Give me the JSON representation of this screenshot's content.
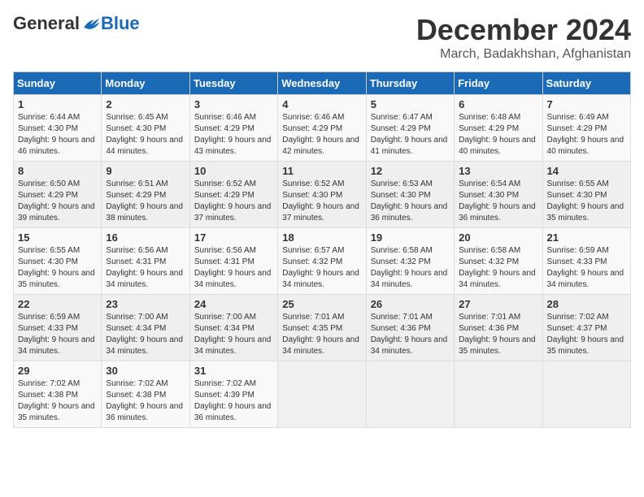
{
  "logo": {
    "general": "General",
    "blue": "Blue"
  },
  "header": {
    "title": "December 2024",
    "subtitle": "March, Badakhshan, Afghanistan"
  },
  "weekdays": [
    "Sunday",
    "Monday",
    "Tuesday",
    "Wednesday",
    "Thursday",
    "Friday",
    "Saturday"
  ],
  "weeks": [
    [
      {
        "day": "1",
        "sunrise": "6:44 AM",
        "sunset": "4:30 PM",
        "daylight": "9 hours and 46 minutes."
      },
      {
        "day": "2",
        "sunrise": "6:45 AM",
        "sunset": "4:30 PM",
        "daylight": "9 hours and 44 minutes."
      },
      {
        "day": "3",
        "sunrise": "6:46 AM",
        "sunset": "4:29 PM",
        "daylight": "9 hours and 43 minutes."
      },
      {
        "day": "4",
        "sunrise": "6:46 AM",
        "sunset": "4:29 PM",
        "daylight": "9 hours and 42 minutes."
      },
      {
        "day": "5",
        "sunrise": "6:47 AM",
        "sunset": "4:29 PM",
        "daylight": "9 hours and 41 minutes."
      },
      {
        "day": "6",
        "sunrise": "6:48 AM",
        "sunset": "4:29 PM",
        "daylight": "9 hours and 40 minutes."
      },
      {
        "day": "7",
        "sunrise": "6:49 AM",
        "sunset": "4:29 PM",
        "daylight": "9 hours and 40 minutes."
      }
    ],
    [
      {
        "day": "8",
        "sunrise": "6:50 AM",
        "sunset": "4:29 PM",
        "daylight": "9 hours and 39 minutes."
      },
      {
        "day": "9",
        "sunrise": "6:51 AM",
        "sunset": "4:29 PM",
        "daylight": "9 hours and 38 minutes."
      },
      {
        "day": "10",
        "sunrise": "6:52 AM",
        "sunset": "4:29 PM",
        "daylight": "9 hours and 37 minutes."
      },
      {
        "day": "11",
        "sunrise": "6:52 AM",
        "sunset": "4:30 PM",
        "daylight": "9 hours and 37 minutes."
      },
      {
        "day": "12",
        "sunrise": "6:53 AM",
        "sunset": "4:30 PM",
        "daylight": "9 hours and 36 minutes."
      },
      {
        "day": "13",
        "sunrise": "6:54 AM",
        "sunset": "4:30 PM",
        "daylight": "9 hours and 36 minutes."
      },
      {
        "day": "14",
        "sunrise": "6:55 AM",
        "sunset": "4:30 PM",
        "daylight": "9 hours and 35 minutes."
      }
    ],
    [
      {
        "day": "15",
        "sunrise": "6:55 AM",
        "sunset": "4:30 PM",
        "daylight": "9 hours and 35 minutes."
      },
      {
        "day": "16",
        "sunrise": "6:56 AM",
        "sunset": "4:31 PM",
        "daylight": "9 hours and 34 minutes."
      },
      {
        "day": "17",
        "sunrise": "6:56 AM",
        "sunset": "4:31 PM",
        "daylight": "9 hours and 34 minutes."
      },
      {
        "day": "18",
        "sunrise": "6:57 AM",
        "sunset": "4:32 PM",
        "daylight": "9 hours and 34 minutes."
      },
      {
        "day": "19",
        "sunrise": "6:58 AM",
        "sunset": "4:32 PM",
        "daylight": "9 hours and 34 minutes."
      },
      {
        "day": "20",
        "sunrise": "6:58 AM",
        "sunset": "4:32 PM",
        "daylight": "9 hours and 34 minutes."
      },
      {
        "day": "21",
        "sunrise": "6:59 AM",
        "sunset": "4:33 PM",
        "daylight": "9 hours and 34 minutes."
      }
    ],
    [
      {
        "day": "22",
        "sunrise": "6:59 AM",
        "sunset": "4:33 PM",
        "daylight": "9 hours and 34 minutes."
      },
      {
        "day": "23",
        "sunrise": "7:00 AM",
        "sunset": "4:34 PM",
        "daylight": "9 hours and 34 minutes."
      },
      {
        "day": "24",
        "sunrise": "7:00 AM",
        "sunset": "4:34 PM",
        "daylight": "9 hours and 34 minutes."
      },
      {
        "day": "25",
        "sunrise": "7:01 AM",
        "sunset": "4:35 PM",
        "daylight": "9 hours and 34 minutes."
      },
      {
        "day": "26",
        "sunrise": "7:01 AM",
        "sunset": "4:36 PM",
        "daylight": "9 hours and 34 minutes."
      },
      {
        "day": "27",
        "sunrise": "7:01 AM",
        "sunset": "4:36 PM",
        "daylight": "9 hours and 35 minutes."
      },
      {
        "day": "28",
        "sunrise": "7:02 AM",
        "sunset": "4:37 PM",
        "daylight": "9 hours and 35 minutes."
      }
    ],
    [
      {
        "day": "29",
        "sunrise": "7:02 AM",
        "sunset": "4:38 PM",
        "daylight": "9 hours and 35 minutes."
      },
      {
        "day": "30",
        "sunrise": "7:02 AM",
        "sunset": "4:38 PM",
        "daylight": "9 hours and 36 minutes."
      },
      {
        "day": "31",
        "sunrise": "7:02 AM",
        "sunset": "4:39 PM",
        "daylight": "9 hours and 36 minutes."
      },
      null,
      null,
      null,
      null
    ]
  ]
}
